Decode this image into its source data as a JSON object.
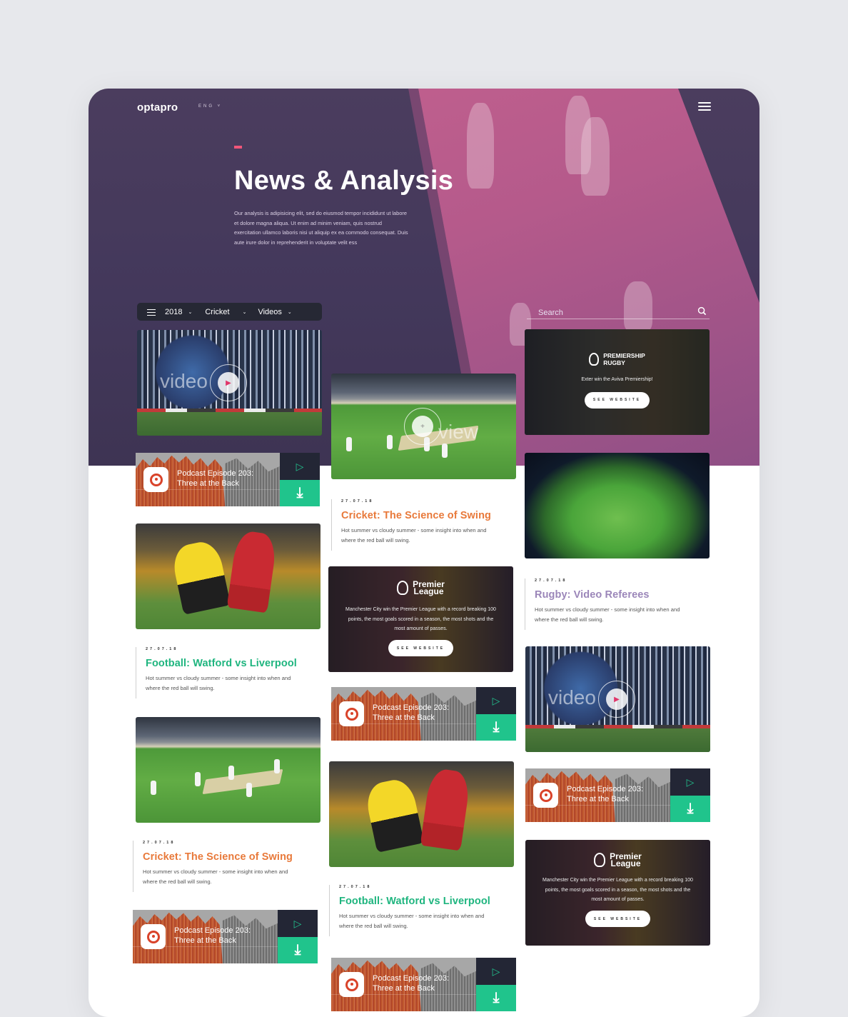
{
  "brand": {
    "logo": "optapro",
    "lang": "ENG ˅"
  },
  "hero": {
    "title": "News & Analysis",
    "description": "Our analysis is adipisicing elit, sed do eiusmod tempor incididunt ut labore et dolore magna aliqua. Ut enim ad minim veniam, quis nostrud exercitation ullamco laboris nisi ut aliquip ex ea commodo consequat. Duis aute irure dolor in reprehenderit in voluptate velit ess"
  },
  "filters": {
    "year": "2018",
    "sport": "Cricket",
    "type": "Videos"
  },
  "search": {
    "placeholder": "Search"
  },
  "video_words": {
    "video": "video",
    "view": "view"
  },
  "podcast": {
    "line1": "Podcast Episode 203:",
    "line2": "Three at the Back"
  },
  "rugby_promo": {
    "logo_line1": "PREMIERSHIP",
    "logo_line2": "RUGBY",
    "text": "Exter win the Aviva Premiership!",
    "button": "SEE WEBSITE"
  },
  "pl_promo": {
    "logo_line1": "Premier",
    "logo_line2": "League",
    "text": "Manchester City win the Premier League with a record breaking 100 points, the most goals scored in a season, the most shots and the most amount of passes.",
    "button": "SEE WEBSITE"
  },
  "articles": {
    "cricket": {
      "date": "27.07.18",
      "title": "Cricket: The Science of Swing",
      "desc": "Hot summer vs cloudy summer - some insight into when and where the red ball will swing.",
      "color": "#e8793a"
    },
    "football": {
      "date": "27.07.18",
      "title": "Football: Watford vs Liverpool",
      "desc": "Hot summer vs cloudy summer - some insight into when and where the red ball will swing.",
      "color": "#1fb57f"
    },
    "rugby": {
      "date": "27.07.18",
      "title": "Rugby: Video Referees",
      "desc": "Hot summer vs cloudy summer - some insight into when and where the red ball will swing.",
      "color": "#9b86b9"
    }
  },
  "icons": {
    "play": "▷",
    "download": "⤓"
  }
}
